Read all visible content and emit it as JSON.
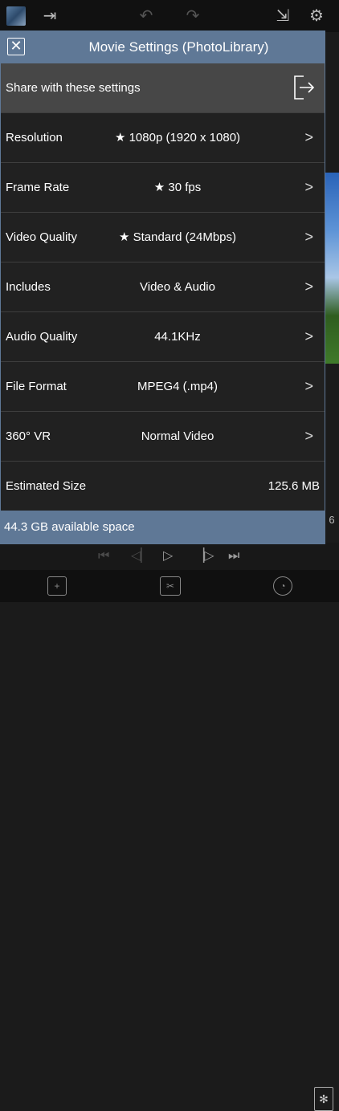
{
  "modal": {
    "title": "Movie Settings (PhotoLibrary)",
    "share_label": "Share with these settings",
    "rows": [
      {
        "label": "Resolution",
        "value": "★ 1080p (1920 x 1080)"
      },
      {
        "label": "Frame Rate",
        "value": "★ 30 fps"
      },
      {
        "label": "Video Quality",
        "value": "★ Standard (24Mbps)"
      },
      {
        "label": "Includes",
        "value": "Video & Audio"
      },
      {
        "label": "Audio Quality",
        "value": "44.1KHz"
      },
      {
        "label": "File Format",
        "value": "MPEG4 (.mp4)"
      },
      {
        "label": "360° VR",
        "value": "Normal Video"
      }
    ],
    "estimated": {
      "label": "Estimated Size",
      "value": "125.6 MB"
    },
    "available_space": "44.3 GB available space"
  },
  "background": {
    "side_number": "6"
  },
  "colors": {
    "accent": "#5f7896",
    "share_row": "#474747",
    "modal_bg": "#212121"
  }
}
